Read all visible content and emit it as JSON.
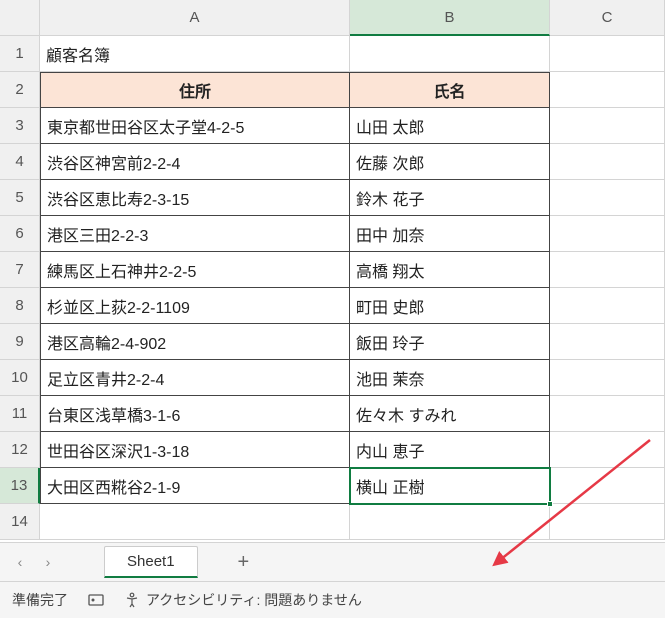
{
  "columns": [
    "A",
    "B",
    "C"
  ],
  "title_cell": "顧客名簿",
  "headers": {
    "address": "住所",
    "name": "氏名"
  },
  "rows": [
    {
      "r": 3,
      "address": "東京都世田谷区太子堂4-2-5",
      "name": "山田 太郎"
    },
    {
      "r": 4,
      "address": "渋谷区神宮前2-2-4",
      "name": "佐藤 次郎"
    },
    {
      "r": 5,
      "address": "渋谷区恵比寿2-3-15",
      "name": "鈴木 花子"
    },
    {
      "r": 6,
      "address": "港区三田2-2-3",
      "name": "田中 加奈"
    },
    {
      "r": 7,
      "address": "練馬区上石神井2-2-5",
      "name": "高橋 翔太"
    },
    {
      "r": 8,
      "address": "杉並区上荻2-2-1109",
      "name": "町田 史郎"
    },
    {
      "r": 9,
      "address": "港区高輪2-4-902",
      "name": "飯田 玲子"
    },
    {
      "r": 10,
      "address": "足立区青井2-2-4",
      "name": "池田 茉奈"
    },
    {
      "r": 11,
      "address": "台東区浅草橋3-1-6",
      "name": "佐々木 すみれ"
    },
    {
      "r": 12,
      "address": "世田谷区深沢1-3-18",
      "name": "内山 恵子"
    },
    {
      "r": 13,
      "address": "大田区西糀谷2-1-9",
      "name": "横山 正樹"
    }
  ],
  "active_cell": {
    "col": "B",
    "row": 13
  },
  "sheet_tab": "Sheet1",
  "status": {
    "ready": "準備完了",
    "accessibility": "アクセシビリティ: 問題ありません"
  }
}
